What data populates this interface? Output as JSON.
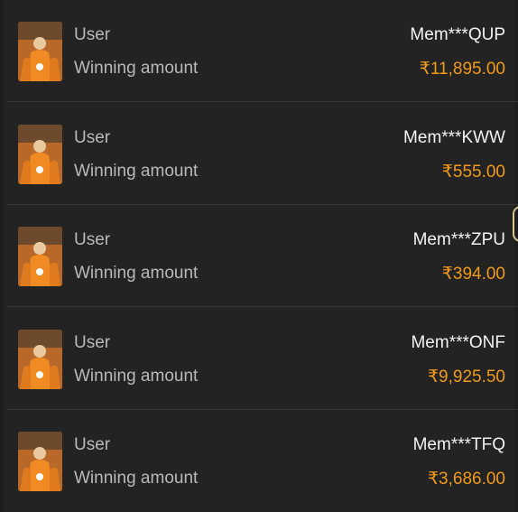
{
  "list": {
    "rows": [
      {
        "user_label": "User",
        "user_value": "Mem***QUP",
        "amount_label": "Winning amount",
        "amount_value": "₹11,895.00"
      },
      {
        "user_label": "User",
        "user_value": "Mem***KWW",
        "amount_label": "Winning amount",
        "amount_value": "₹555.00"
      },
      {
        "user_label": "User",
        "user_value": "Mem***ZPU",
        "amount_label": "Winning amount",
        "amount_value": "₹394.00"
      },
      {
        "user_label": "User",
        "user_value": "Mem***ONF",
        "amount_label": "Winning amount",
        "amount_value": "₹9,925.50"
      },
      {
        "user_label": "User",
        "user_value": "Mem***TFQ",
        "amount_label": "Winning amount",
        "amount_value": "₹3,686.00"
      }
    ]
  },
  "colors": {
    "background": "#1e1e1e",
    "panel": "#232323",
    "label": "#b9b9b9",
    "username": "#f3f3f3",
    "amount": "#f19a1c"
  },
  "icons": {
    "thumbnail": "game-thumbnail-icon"
  }
}
